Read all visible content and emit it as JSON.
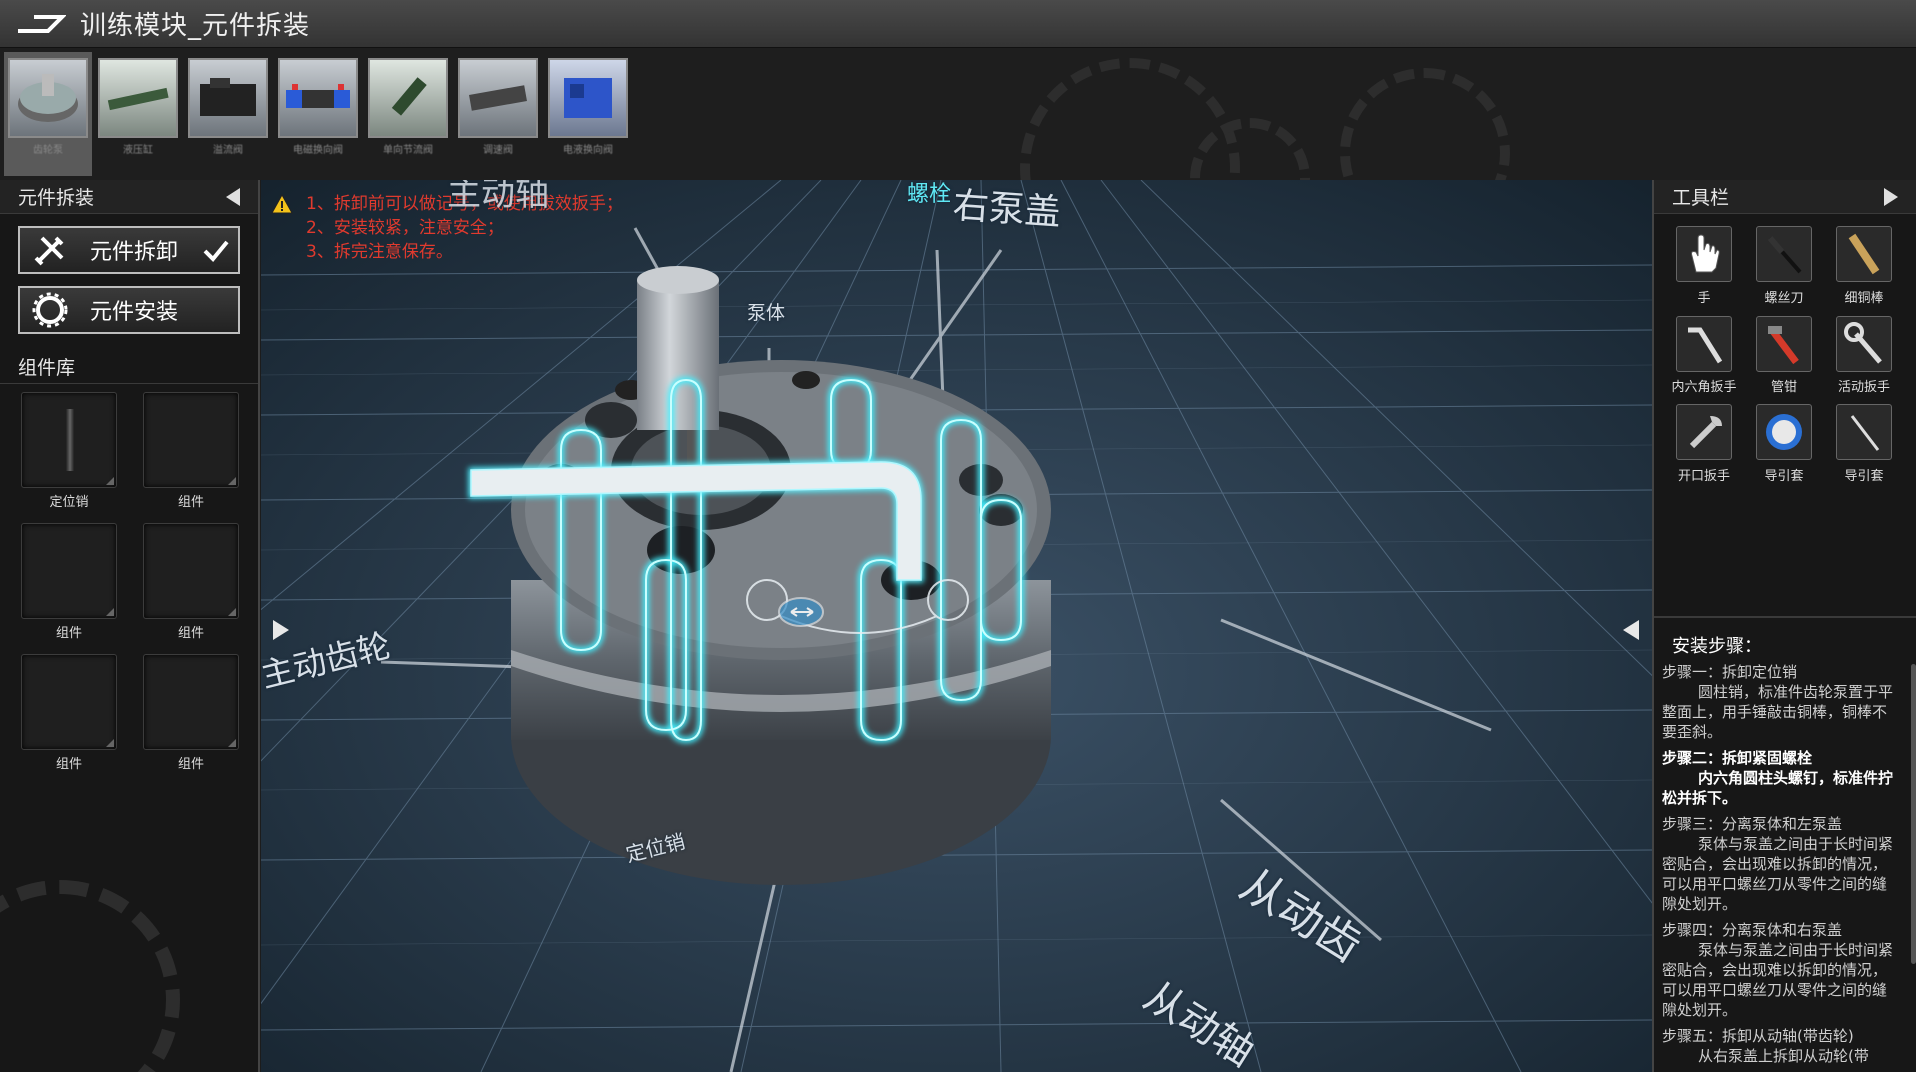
{
  "titlebar": {
    "title": "训练模块_元件拆装",
    "logo_icon": "brand-logo-icon"
  },
  "top_strip": {
    "components": [
      {
        "label": "齿轮泵",
        "selected": true
      },
      {
        "label": "液压缸"
      },
      {
        "label": "溢流阀"
      },
      {
        "label": "电磁换向阀"
      },
      {
        "label": "单向节流阀"
      },
      {
        "label": "调速阀"
      },
      {
        "label": "电液换向阀"
      }
    ]
  },
  "left_panel": {
    "header": "元件拆装",
    "disassemble_label": "元件拆卸",
    "install_label": "元件安装",
    "library_header": "组件库",
    "slots": [
      "定位销",
      "组件",
      "组件",
      "组件",
      "组件",
      "组件"
    ]
  },
  "viewport": {
    "warnings": [
      "1、拆卸前可以做记号，或使用拔效扳手；",
      "2、安装较紧，注意安全；",
      "3、拆完注意保存。"
    ],
    "labels": {
      "drive_shaft": "主动轴",
      "bolt": "螺栓",
      "right_cover": "右泵盖",
      "pump_body": "泵体",
      "drive_gear": "主动齿轮",
      "locating_pin": "定位销",
      "driven_gear": "从动齿",
      "driven_shaft": "从动轴"
    }
  },
  "right_panel": {
    "toolbar_header": "工具栏",
    "tools": [
      {
        "label": "手",
        "icon": "hand-icon"
      },
      {
        "label": "螺丝刀",
        "icon": "screwdriver-icon"
      },
      {
        "label": "细铜棒",
        "icon": "copper-rod-icon"
      },
      {
        "label": "内六角扳手",
        "icon": "hex-key-icon"
      },
      {
        "label": "管钳",
        "icon": "pipe-wrench-icon"
      },
      {
        "label": "活动扳手",
        "icon": "adjustable-wrench-icon"
      },
      {
        "label": "开口扳手",
        "icon": "open-wrench-icon"
      },
      {
        "label": "导引套",
        "icon": "guide-sleeve-icon"
      },
      {
        "label": "导引套",
        "icon": "guide-rod-icon"
      }
    ],
    "steps_title": "安装步骤：",
    "steps": [
      {
        "title": "步骤一：拆卸定位销",
        "body": "圆柱销，标准件齿轮泵置于平整面上，用手锤敲击铜棒，铜棒不要歪斜。"
      },
      {
        "title": "步骤二：拆卸紧固螺栓",
        "body": "内六角圆柱头螺钉，标准件拧松并拆下。",
        "active": true
      },
      {
        "title": "步骤三：分离泵体和左泵盖",
        "body": "泵体与泵盖之间由于长时间紧密贴合，会出现难以拆卸的情况，可以用平口螺丝刀从零件之间的缝隙处划开。"
      },
      {
        "title": "步骤四：分离泵体和右泵盖",
        "body": "泵体与泵盖之间由于长时间紧密贴合，会出现难以拆卸的情况，可以用平口螺丝刀从零件之间的缝隙处划开。"
      },
      {
        "title": "步骤五：拆卸从动轴(带齿轮)",
        "body": "从右泵盖上拆卸从动轮(带"
      }
    ]
  },
  "colors": {
    "warning_red": "#e03a2e",
    "glow_cyan": "#3ff0ff",
    "grid_blue": "#6f8aa3"
  }
}
